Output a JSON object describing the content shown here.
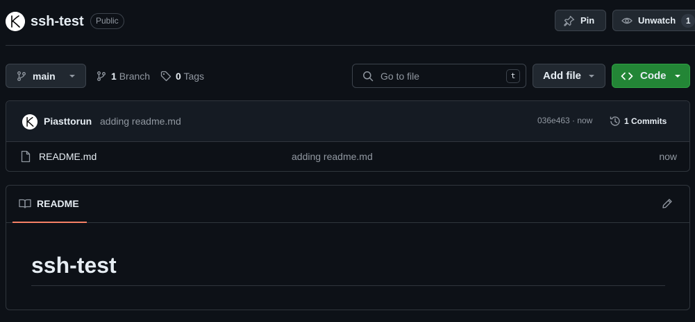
{
  "repo": {
    "name": "ssh-test",
    "visibility": "Public"
  },
  "header_actions": {
    "pin_label": "Pin",
    "unwatch_label": "Unwatch",
    "watch_count": "1"
  },
  "toolbar": {
    "branch": "main",
    "branch_count": "1",
    "branch_label": "Branch",
    "tag_count": "0",
    "tag_label": "Tags",
    "search_placeholder": "Go to file",
    "search_shortcut": "t",
    "add_file_label": "Add file",
    "code_label": "Code"
  },
  "latest_commit": {
    "author": "Piasttorun",
    "message": "adding readme.md",
    "sha_time": "036e463 · now",
    "commits_label": "1 Commits"
  },
  "files": [
    {
      "name": "README.md",
      "commit_message": "adding readme.md",
      "time": "now"
    }
  ],
  "readme": {
    "tab_label": "README",
    "heading": "ssh-test"
  },
  "colors": {
    "background": "#0d1117",
    "border": "#30363d",
    "code_button": "#238636",
    "active_tab_underline": "#f78166",
    "muted_text": "#9198a1"
  }
}
